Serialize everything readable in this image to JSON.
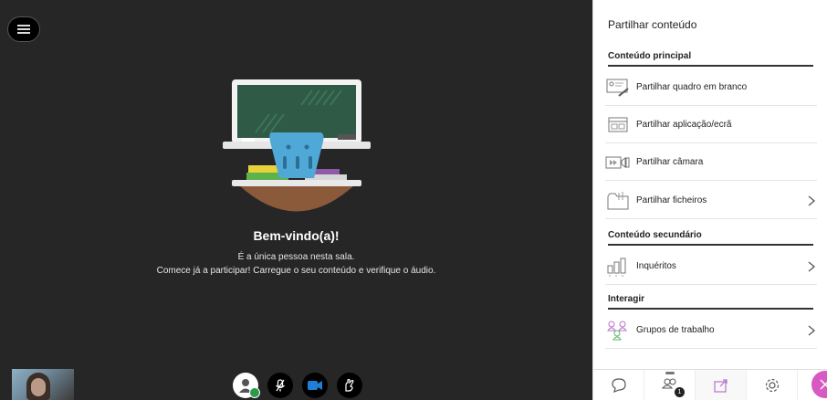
{
  "stage": {
    "welcome_title": "Bem-vindo(a)!",
    "welcome_line1": "É a única pessoa nesta sala.",
    "welcome_line2": "Comece já a participar! Carregue o seu conteúdo e verifique o áudio."
  },
  "panel": {
    "title": "Partilhar conteúdo",
    "sections": [
      {
        "heading": "Conteúdo principal",
        "items": [
          {
            "label": "Partilhar quadro em branco",
            "icon": "whiteboard-icon"
          },
          {
            "label": "Partilhar aplicação/ecrã",
            "icon": "screen-share-icon"
          },
          {
            "label": "Partilhar câmara",
            "icon": "camera-share-icon"
          },
          {
            "label": "Partilhar ficheiros",
            "icon": "folder-icon"
          }
        ]
      },
      {
        "heading": "Conteúdo secundário",
        "items": [
          {
            "label": "Inquéritos",
            "icon": "poll-icon"
          }
        ]
      },
      {
        "heading": "Interagir",
        "items": [
          {
            "label": "Grupos de trabalho",
            "icon": "breakout-groups-icon"
          }
        ]
      }
    ]
  },
  "tabbar": {
    "people_count": "1"
  },
  "colors": {
    "stage_bg": "#262626",
    "accent": "#d65ac1",
    "ok_green": "#2b9b4a",
    "cam_blue": "#1f7fd6"
  }
}
